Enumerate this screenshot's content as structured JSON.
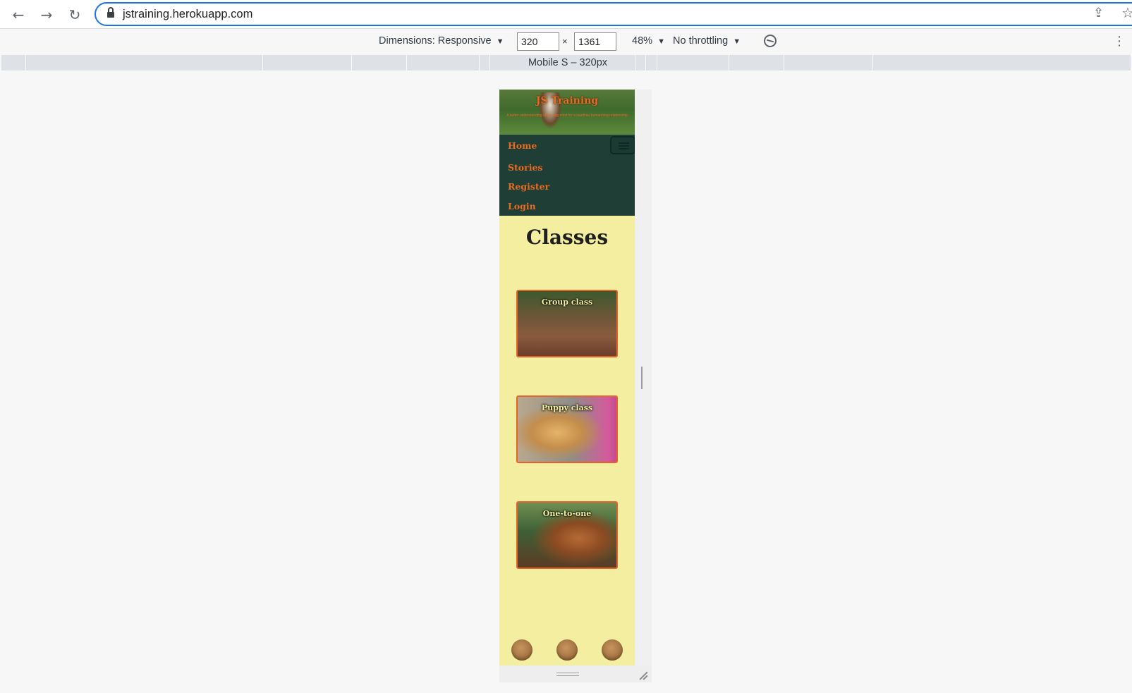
{
  "browser": {
    "url": "jstraining.herokuapp.com",
    "back_icon": "←",
    "forward_icon": "→",
    "reload_icon": "↻",
    "share_icon": "⇪",
    "star_icon": "☆"
  },
  "device_toolbar": {
    "dimensions_label": "Dimensions: Responsive",
    "caret": "▼",
    "width_value": "320",
    "times": "×",
    "height_value": "1361",
    "zoom": "48%",
    "throttling": "No throttling",
    "more_icon": "⋮"
  },
  "media_query_bar": {
    "label": "Mobile S – 320px"
  },
  "site": {
    "brand": "JS Training",
    "tagline": "A better understanding of the dog mind for a healthier human/dog relationship",
    "nav": [
      {
        "label": "Home"
      },
      {
        "label": "Stories"
      },
      {
        "label": "Register"
      },
      {
        "label": "Login"
      }
    ],
    "page_title": "Classes",
    "classes": [
      {
        "label": "Group class"
      },
      {
        "label": "Puppy class"
      },
      {
        "label": "One-to-one"
      }
    ]
  },
  "colors": {
    "page_background": "#f4efa0",
    "nav_background": "#1e3e36",
    "accent_orange": "#ea6a1f",
    "card_border": "#e7622b",
    "omnibox_focus": "#1a73e8"
  }
}
